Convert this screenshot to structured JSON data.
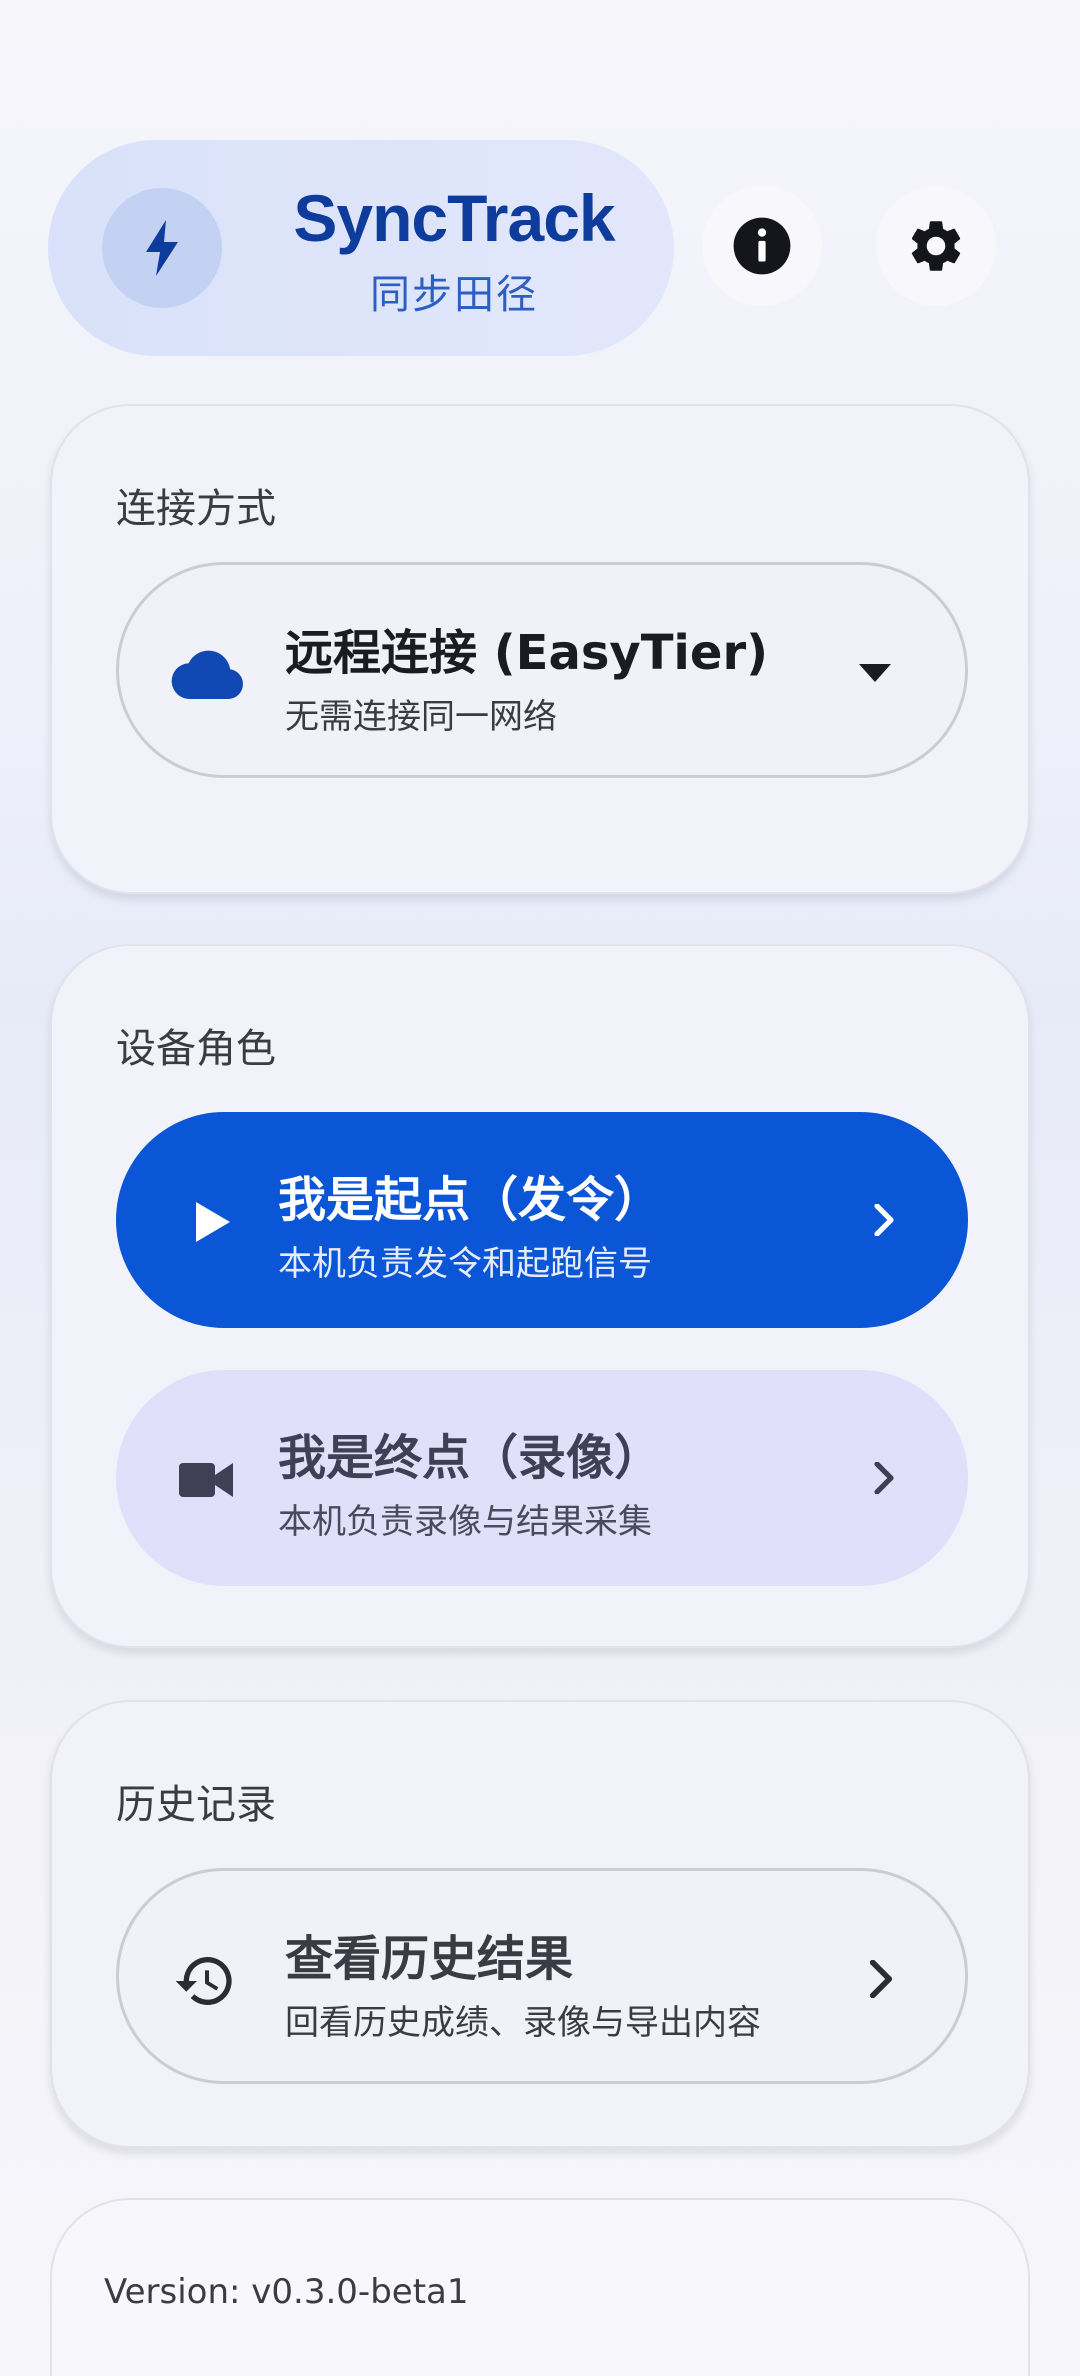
{
  "app": {
    "title": "SyncTrack",
    "subtitle": "同步田径"
  },
  "header": {
    "info_icon": "info-icon",
    "settings_icon": "gear-icon"
  },
  "connection": {
    "section_label": "连接方式",
    "selected": {
      "title": "远程连接 (EasyTier)",
      "subtitle": "无需连接同一网络",
      "icon": "cloud-icon"
    }
  },
  "role": {
    "section_label": "设备角色",
    "start": {
      "title": "我是起点（发令）",
      "subtitle": "本机负责发令和起跑信号",
      "icon": "play-icon"
    },
    "finish": {
      "title": "我是终点（录像）",
      "subtitle": "本机负责录像与结果采集",
      "icon": "video-camera-icon"
    }
  },
  "history": {
    "section_label": "历史记录",
    "view": {
      "title": "查看历史结果",
      "subtitle": "回看历史成绩、录像与导出内容",
      "icon": "history-icon"
    }
  },
  "footer": {
    "version": "Version: v0.3.0-beta1"
  },
  "colors": {
    "primary": "#0a56d6",
    "brand_text": "#0d3c9c",
    "secondary_container": "#e1e0fa"
  }
}
